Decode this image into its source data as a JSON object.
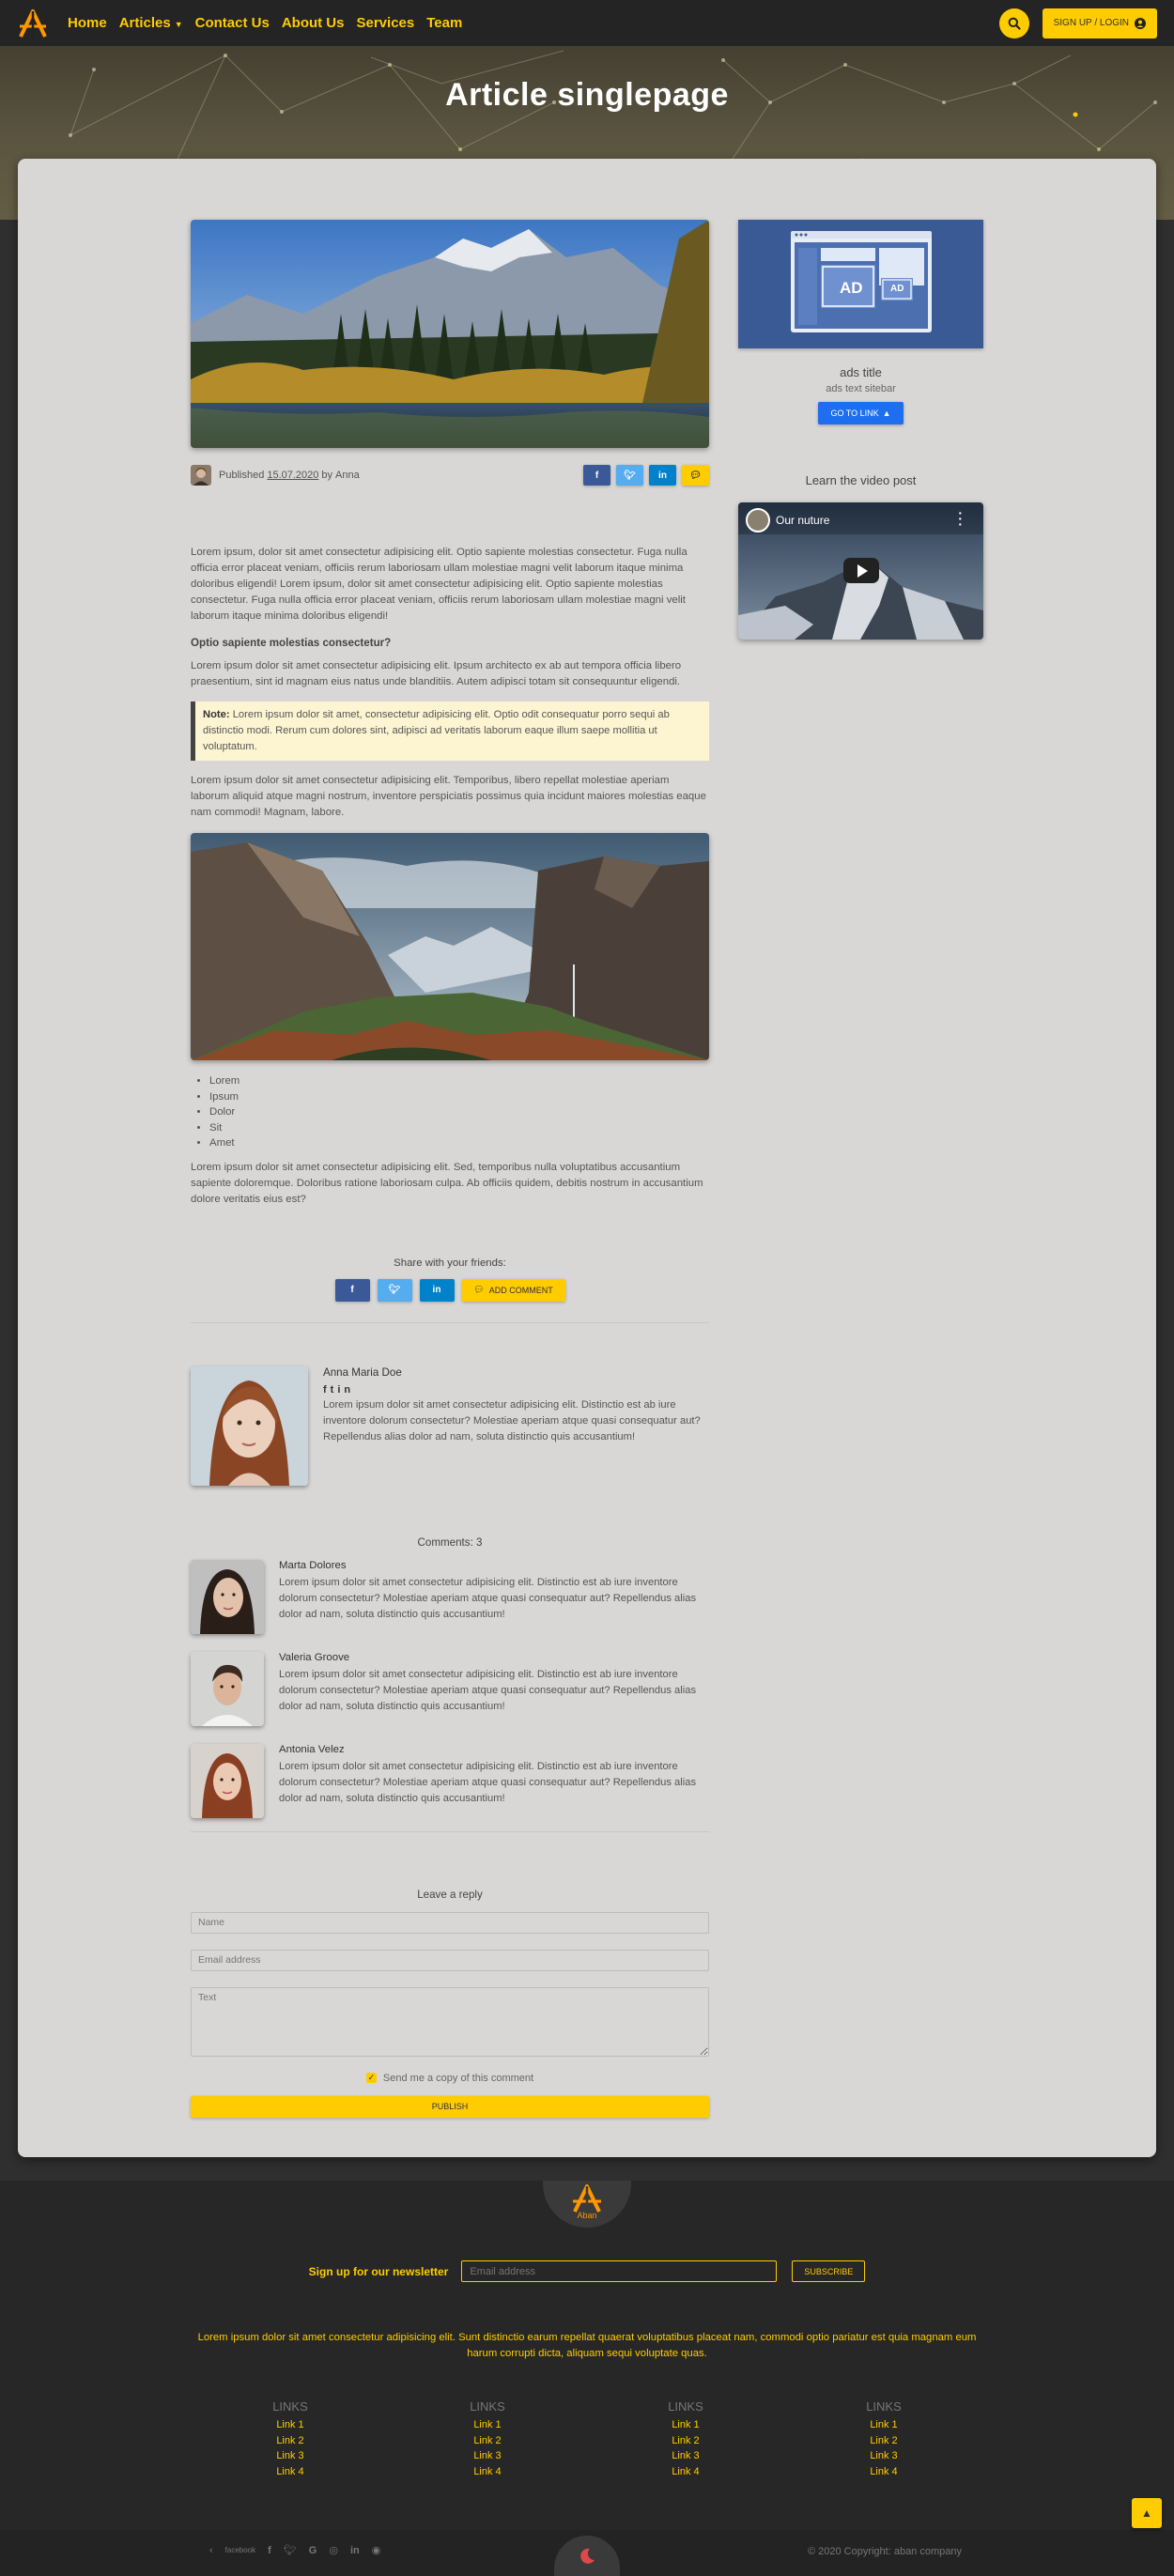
{
  "nav": {
    "items": [
      {
        "label": "Home"
      },
      {
        "label": "Articles"
      },
      {
        "label": "Contact Us"
      },
      {
        "label": "About Us"
      },
      {
        "label": "Services"
      },
      {
        "label": "Team"
      }
    ],
    "signup_label": "SIGN UP / LOGIN"
  },
  "hero": {
    "title": "Article singlepage"
  },
  "article": {
    "meta": {
      "published_label": "Published",
      "date": "15.07.2020",
      "by_label": "by",
      "author": "Anna"
    },
    "p1": "Lorem ipsum, dolor sit amet consectetur adipisicing elit. Optio sapiente molestias consectetur. Fuga nulla officia error placeat veniam, officiis rerum laboriosam ullam molestiae magni velit laborum itaque minima doloribus eligendi! Lorem ipsum, dolor sit amet consectetur adipisicing elit. Optio sapiente molestias consectetur. Fuga nulla officia error placeat veniam, officiis rerum laboriosam ullam molestiae magni velit laborum itaque minima doloribus eligendi!",
    "subhead": "Optio sapiente molestias consectetur?",
    "p2": "Lorem ipsum dolor sit amet consectetur adipisicing elit. Ipsum architecto ex ab aut tempora officia libero praesentium, sint id magnam eius natus unde blanditiis. Autem adipisci totam sit consequuntur eligendi.",
    "note_label": "Note:",
    "note_text": " Lorem ipsum dolor sit amet, consectetur adipisicing elit. Optio odit consequatur porro sequi ab distinctio modi. Rerum cum dolores sint, adipisci ad veritatis laborum eaque illum saepe mollitia ut voluptatum.",
    "p3": "Lorem ipsum dolor sit amet consectetur adipisicing elit. Temporibus, libero repellat molestiae aperiam laborum aliquid atque magni nostrum, inventore perspiciatis possimus quia incidunt maiores molestias eaque nam commodi! Magnam, labore.",
    "bullets": [
      "Lorem",
      "Ipsum",
      "Dolor",
      "Sit",
      "Amet"
    ],
    "p4": "Lorem ipsum dolor sit amet consectetur adipisicing elit. Sed, temporibus nulla voluptatibus accusantium sapiente doloremque. Doloribus ratione laboriosam culpa. Ab officiis quidem, debitis nostrum in accusantium dolore veritatis eius est?",
    "share_title": "Share with your friends:",
    "add_comment_label": "ADD COMMENT"
  },
  "author": {
    "name": "Anna Maria Doe",
    "text": "Lorem ipsum dolor sit amet consectetur adipisicing elit. Distinctio est ab iure inventore dolorum consectetur? Molestiae aperiam atque quasi consequatur aut? Repellendus alias dolor ad nam, soluta distinctio quis accusantium!"
  },
  "comments": {
    "title": "Comments: 3",
    "items": [
      {
        "name": "Marta Dolores",
        "text": "Lorem ipsum dolor sit amet consectetur adipisicing elit. Distinctio est ab iure inventore dolorum consectetur? Molestiae aperiam atque quasi consequatur aut? Repellendus alias dolor ad nam, soluta distinctio quis accusantium!"
      },
      {
        "name": "Valeria Groove",
        "text": "Lorem ipsum dolor sit amet consectetur adipisicing elit. Distinctio est ab iure inventore dolorum consectetur? Molestiae aperiam atque quasi consequatur aut? Repellendus alias dolor ad nam, soluta distinctio quis accusantium!"
      },
      {
        "name": "Antonia Velez",
        "text": "Lorem ipsum dolor sit amet consectetur adipisicing elit. Distinctio est ab iure inventore dolorum consectetur? Molestiae aperiam atque quasi consequatur aut? Repellendus alias dolor ad nam, soluta distinctio quis accusantium!"
      }
    ]
  },
  "reply": {
    "title": "Leave a reply",
    "name_placeholder": "Name",
    "email_placeholder": "Email address",
    "text_placeholder": "Text",
    "copy_label": "Send me a copy of this comment",
    "publish_label": "PUBLISH"
  },
  "sidebar": {
    "ad_badge": "AD",
    "ads_title": "ads title",
    "ads_text": "ads text sitebar",
    "goto_label": "GO TO LINK",
    "video_title": "Learn the video post",
    "video_label": "Our nuture"
  },
  "footer": {
    "logo_text": "Aban",
    "newsletter_label": "Sign up for our newsletter",
    "newsletter_placeholder": "Email address",
    "subscribe_label": "SUBSCRIBE",
    "text": "Lorem ipsum dolor sit amet consectetur adipisicing elit. Sunt distinctio earum repellat quaerat voluptatibus placeat nam, commodi optio pariatur est quia magnam eum harum corrupti dicta, aliquam sequi voluptate quas.",
    "link_columns": [
      {
        "title": "LINKS",
        "links": [
          "Link 1",
          "Link 2",
          "Link 3",
          "Link 4"
        ]
      },
      {
        "title": "LINKS",
        "links": [
          "Link 1",
          "Link 2",
          "Link 3",
          "Link 4"
        ]
      },
      {
        "title": "LINKS",
        "links": [
          "Link 1",
          "Link 2",
          "Link 3",
          "Link 4"
        ]
      },
      {
        "title": "LINKS",
        "links": [
          "Link 1",
          "Link 2",
          "Link 3",
          "Link 4"
        ]
      }
    ],
    "facebook_label": "facebook",
    "copyright": "© 2020 Copyright: aban company"
  },
  "colors": {
    "accent": "#ffcc00",
    "card": "#d8d7d6",
    "footer": "#272727"
  }
}
